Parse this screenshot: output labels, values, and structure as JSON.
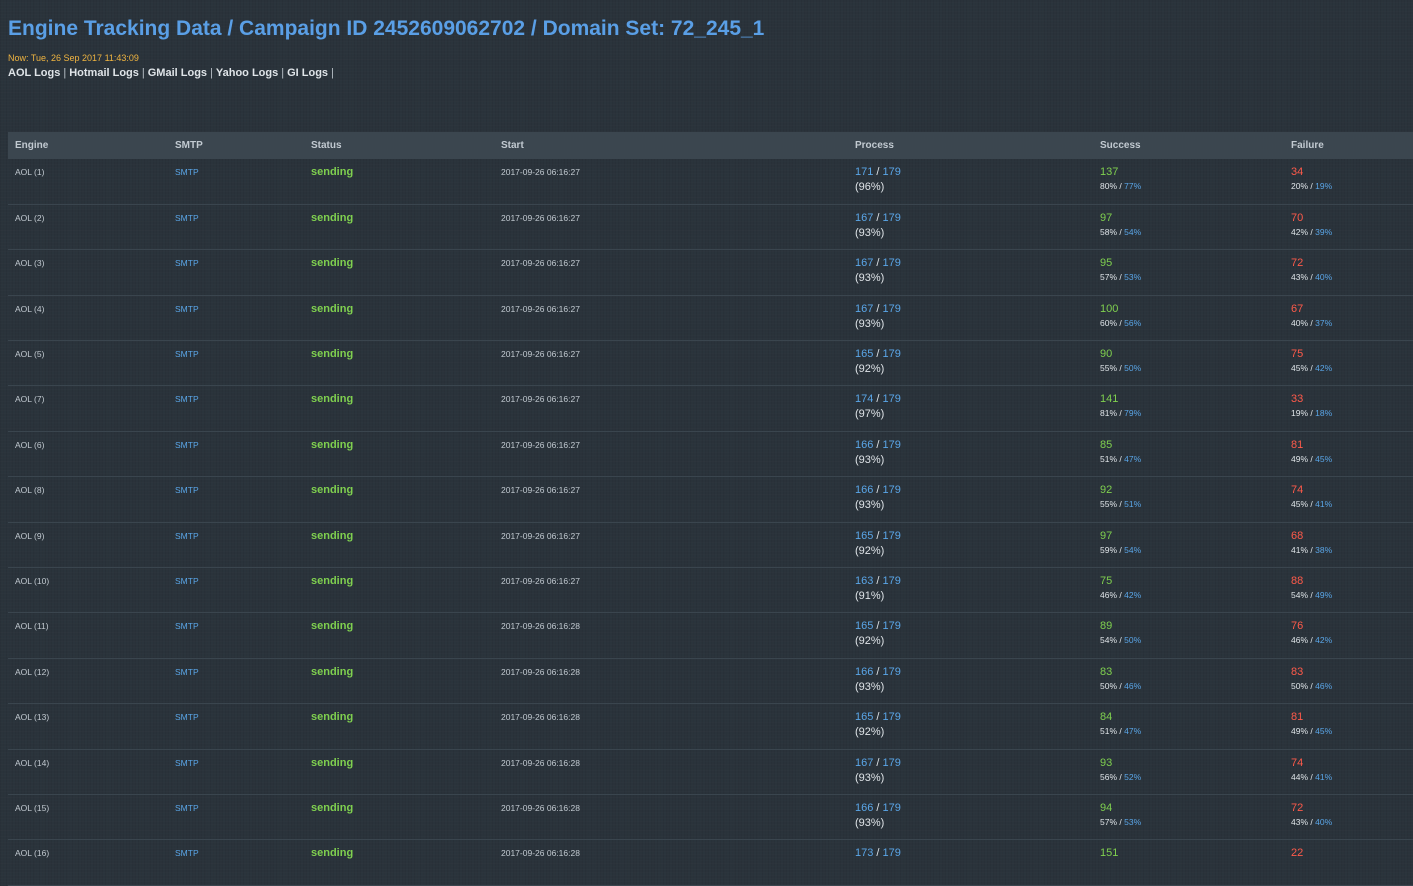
{
  "header": {
    "title": "Engine Tracking Data / Campaign ID 2452609062702 / Domain Set: 72_245_1",
    "now": "Now: Tue, 26 Sep 2017 11:43:09",
    "links": [
      "AOL Logs",
      "Hotmail Logs",
      "GMail Logs",
      "Yahoo Logs",
      "GI Logs"
    ],
    "separator": "|"
  },
  "colors": {
    "background": "#2a333b",
    "title": "#5a9fe6",
    "now": "#f0b440",
    "link_blue": "#5aa6e8",
    "sending_green": "#7fd04f",
    "failure_red": "#ff5a4a"
  },
  "table": {
    "columns": [
      "Engine",
      "SMTP",
      "Status",
      "Start",
      "Process",
      "Success",
      "Failure"
    ],
    "rows": [
      {
        "engine": "AOL (1)",
        "smtp": "SMTP",
        "status": "sending",
        "start": "2017-09-26 06:16:27",
        "processed": "171",
        "total": "179",
        "process_pct": "(96%)",
        "success": "137",
        "success_pct_a": "80%",
        "success_pct_b": "77%",
        "failure": "34",
        "failure_pct_a": "20%",
        "failure_pct_b": "19%"
      },
      {
        "engine": "AOL (2)",
        "smtp": "SMTP",
        "status": "sending",
        "start": "2017-09-26 06:16:27",
        "processed": "167",
        "total": "179",
        "process_pct": "(93%)",
        "success": "97",
        "success_pct_a": "58%",
        "success_pct_b": "54%",
        "failure": "70",
        "failure_pct_a": "42%",
        "failure_pct_b": "39%"
      },
      {
        "engine": "AOL (3)",
        "smtp": "SMTP",
        "status": "sending",
        "start": "2017-09-26 06:16:27",
        "processed": "167",
        "total": "179",
        "process_pct": "(93%)",
        "success": "95",
        "success_pct_a": "57%",
        "success_pct_b": "53%",
        "failure": "72",
        "failure_pct_a": "43%",
        "failure_pct_b": "40%"
      },
      {
        "engine": "AOL (4)",
        "smtp": "SMTP",
        "status": "sending",
        "start": "2017-09-26 06:16:27",
        "processed": "167",
        "total": "179",
        "process_pct": "(93%)",
        "success": "100",
        "success_pct_a": "60%",
        "success_pct_b": "56%",
        "failure": "67",
        "failure_pct_a": "40%",
        "failure_pct_b": "37%"
      },
      {
        "engine": "AOL (5)",
        "smtp": "SMTP",
        "status": "sending",
        "start": "2017-09-26 06:16:27",
        "processed": "165",
        "total": "179",
        "process_pct": "(92%)",
        "success": "90",
        "success_pct_a": "55%",
        "success_pct_b": "50%",
        "failure": "75",
        "failure_pct_a": "45%",
        "failure_pct_b": "42%"
      },
      {
        "engine": "AOL (7)",
        "smtp": "SMTP",
        "status": "sending",
        "start": "2017-09-26 06:16:27",
        "processed": "174",
        "total": "179",
        "process_pct": "(97%)",
        "success": "141",
        "success_pct_a": "81%",
        "success_pct_b": "79%",
        "failure": "33",
        "failure_pct_a": "19%",
        "failure_pct_b": "18%"
      },
      {
        "engine": "AOL (6)",
        "smtp": "SMTP",
        "status": "sending",
        "start": "2017-09-26 06:16:27",
        "processed": "166",
        "total": "179",
        "process_pct": "(93%)",
        "success": "85",
        "success_pct_a": "51%",
        "success_pct_b": "47%",
        "failure": "81",
        "failure_pct_a": "49%",
        "failure_pct_b": "45%"
      },
      {
        "engine": "AOL (8)",
        "smtp": "SMTP",
        "status": "sending",
        "start": "2017-09-26 06:16:27",
        "processed": "166",
        "total": "179",
        "process_pct": "(93%)",
        "success": "92",
        "success_pct_a": "55%",
        "success_pct_b": "51%",
        "failure": "74",
        "failure_pct_a": "45%",
        "failure_pct_b": "41%"
      },
      {
        "engine": "AOL (9)",
        "smtp": "SMTP",
        "status": "sending",
        "start": "2017-09-26 06:16:27",
        "processed": "165",
        "total": "179",
        "process_pct": "(92%)",
        "success": "97",
        "success_pct_a": "59%",
        "success_pct_b": "54%",
        "failure": "68",
        "failure_pct_a": "41%",
        "failure_pct_b": "38%"
      },
      {
        "engine": "AOL (10)",
        "smtp": "SMTP",
        "status": "sending",
        "start": "2017-09-26 06:16:27",
        "processed": "163",
        "total": "179",
        "process_pct": "(91%)",
        "success": "75",
        "success_pct_a": "46%",
        "success_pct_b": "42%",
        "failure": "88",
        "failure_pct_a": "54%",
        "failure_pct_b": "49%"
      },
      {
        "engine": "AOL (11)",
        "smtp": "SMTP",
        "status": "sending",
        "start": "2017-09-26 06:16:28",
        "processed": "165",
        "total": "179",
        "process_pct": "(92%)",
        "success": "89",
        "success_pct_a": "54%",
        "success_pct_b": "50%",
        "failure": "76",
        "failure_pct_a": "46%",
        "failure_pct_b": "42%"
      },
      {
        "engine": "AOL (12)",
        "smtp": "SMTP",
        "status": "sending",
        "start": "2017-09-26 06:16:28",
        "processed": "166",
        "total": "179",
        "process_pct": "(93%)",
        "success": "83",
        "success_pct_a": "50%",
        "success_pct_b": "46%",
        "failure": "83",
        "failure_pct_a": "50%",
        "failure_pct_b": "46%"
      },
      {
        "engine": "AOL (13)",
        "smtp": "SMTP",
        "status": "sending",
        "start": "2017-09-26 06:16:28",
        "processed": "165",
        "total": "179",
        "process_pct": "(92%)",
        "success": "84",
        "success_pct_a": "51%",
        "success_pct_b": "47%",
        "failure": "81",
        "failure_pct_a": "49%",
        "failure_pct_b": "45%"
      },
      {
        "engine": "AOL (14)",
        "smtp": "SMTP",
        "status": "sending",
        "start": "2017-09-26 06:16:28",
        "processed": "167",
        "total": "179",
        "process_pct": "(93%)",
        "success": "93",
        "success_pct_a": "56%",
        "success_pct_b": "52%",
        "failure": "74",
        "failure_pct_a": "44%",
        "failure_pct_b": "41%"
      },
      {
        "engine": "AOL (15)",
        "smtp": "SMTP",
        "status": "sending",
        "start": "2017-09-26 06:16:28",
        "processed": "166",
        "total": "179",
        "process_pct": "(93%)",
        "success": "94",
        "success_pct_a": "57%",
        "success_pct_b": "53%",
        "failure": "72",
        "failure_pct_a": "43%",
        "failure_pct_b": "40%"
      },
      {
        "engine": "AOL (16)",
        "smtp": "SMTP",
        "status": "sending",
        "start": "2017-09-26 06:16:28",
        "processed": "173",
        "total": "179",
        "process_pct": "",
        "success": "151",
        "success_pct_a": "",
        "success_pct_b": "",
        "failure": "22",
        "failure_pct_a": "",
        "failure_pct_b": ""
      }
    ]
  }
}
